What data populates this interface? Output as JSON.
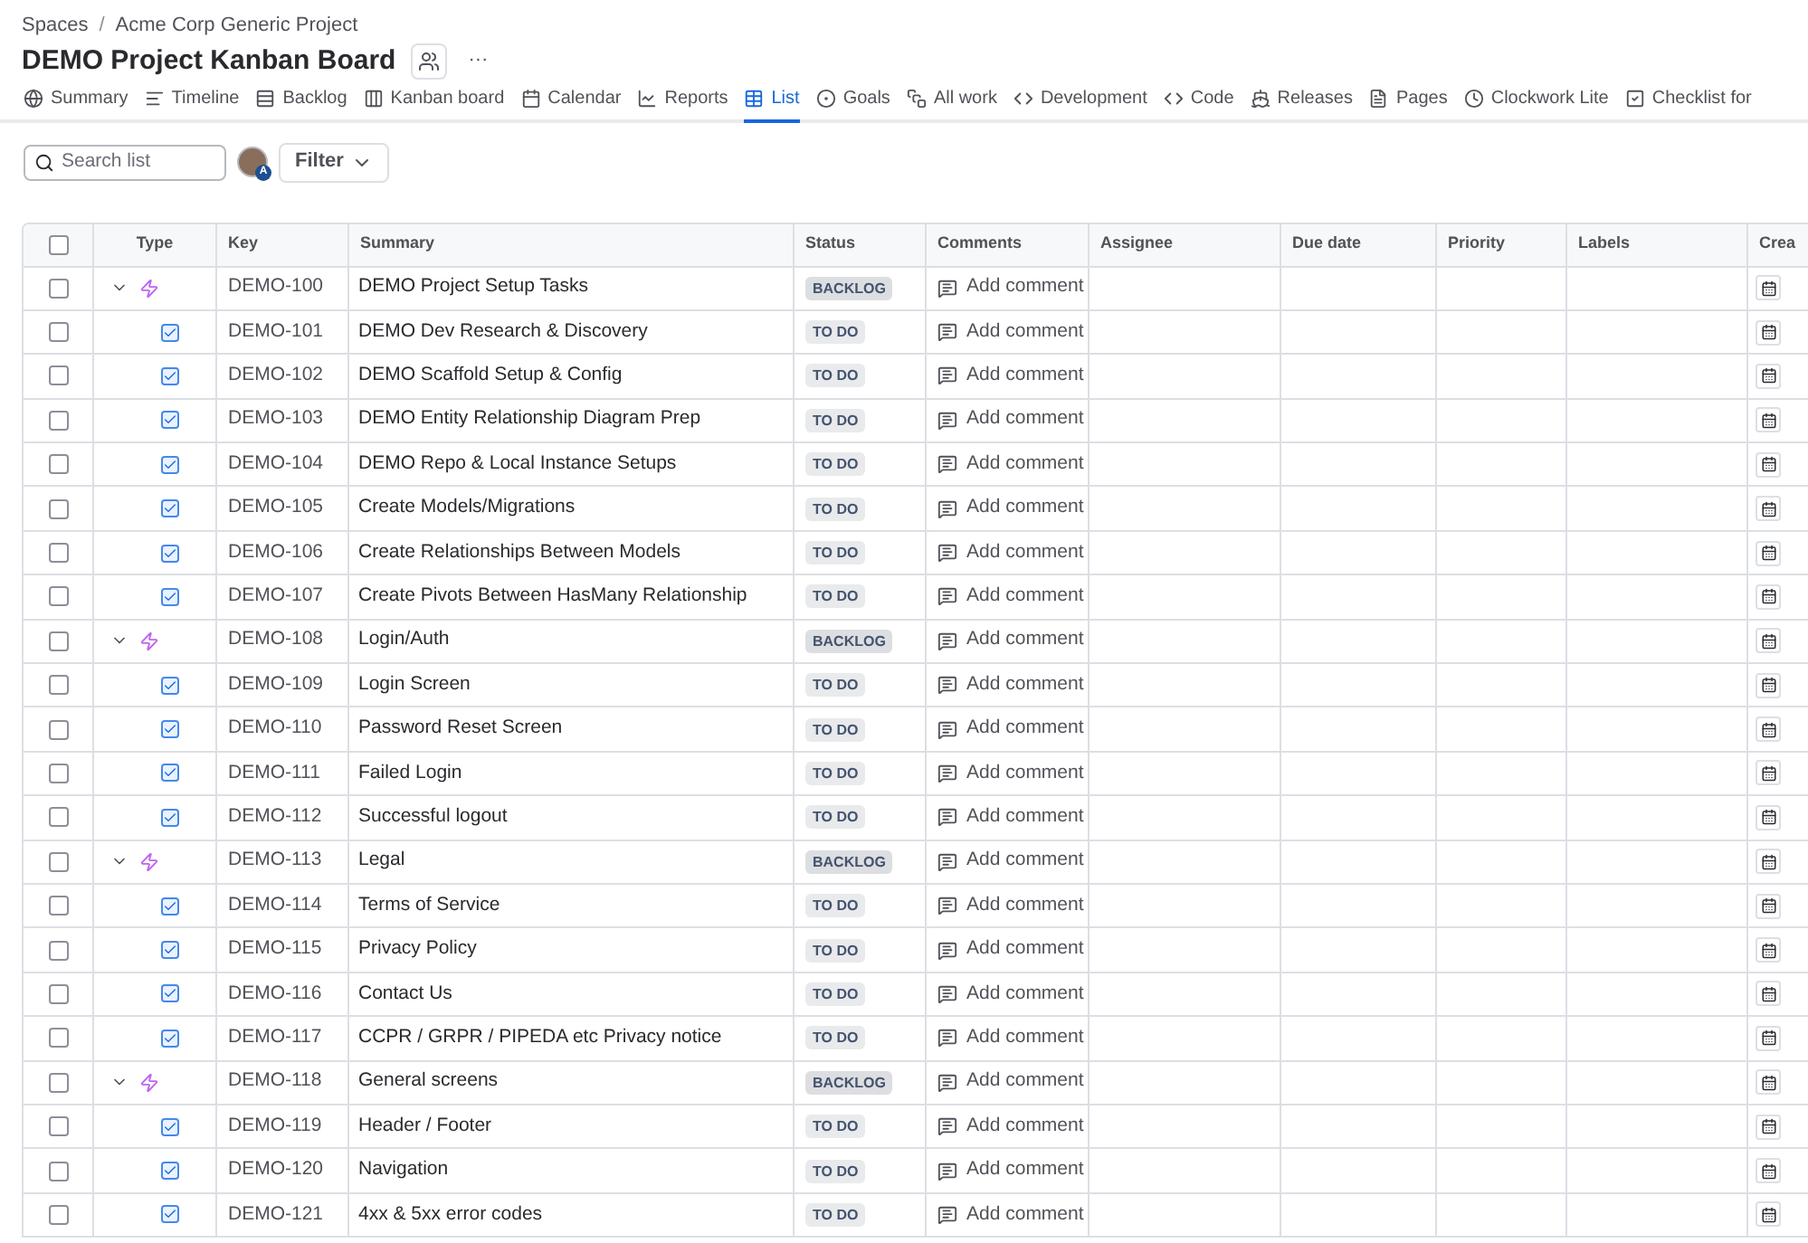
{
  "breadcrumbs": [
    "Spaces",
    "Acme Corp Generic Project"
  ],
  "breadcrumb_separator": "/",
  "title": "DEMO Project Kanban Board",
  "more": "···",
  "tabs": [
    {
      "label": "Summary",
      "selected": false
    },
    {
      "label": "Timeline",
      "selected": false
    },
    {
      "label": "Backlog",
      "selected": false
    },
    {
      "label": "Kanban board",
      "selected": false
    },
    {
      "label": "Calendar",
      "selected": false
    },
    {
      "label": "Reports",
      "selected": false
    },
    {
      "label": "List",
      "selected": true
    },
    {
      "label": "Goals",
      "selected": false
    },
    {
      "label": "All work",
      "selected": false
    },
    {
      "label": "Development",
      "selected": false
    },
    {
      "label": "Code",
      "selected": false
    },
    {
      "label": "Releases",
      "selected": false
    },
    {
      "label": "Pages",
      "selected": false
    },
    {
      "label": "Clockwork Lite",
      "selected": false
    },
    {
      "label": "Checklist for",
      "selected": false
    }
  ],
  "search": {
    "placeholder": "Search list"
  },
  "avatar_badge": "A",
  "filter": "Filter",
  "table": {
    "select_all": {
      "checked": false
    },
    "columns": [
      "Type",
      "Key",
      "Summary",
      "Status",
      "Comments",
      "Assignee",
      "Due date",
      "Priority",
      "Labels",
      "Crea"
    ],
    "rows": [
      {
        "kind": "epic",
        "expanded": true,
        "checked": false,
        "key": "DEMO-100",
        "summary": "DEMO Project Setup Tasks",
        "status": "BACKLOG",
        "comment": "Add comment"
      },
      {
        "kind": "task",
        "checked": false,
        "key": "DEMO-101",
        "summary": "DEMO Dev Research & Discovery",
        "status": "TO DO",
        "comment": "Add comment"
      },
      {
        "kind": "task",
        "checked": false,
        "key": "DEMO-102",
        "summary": "DEMO Scaffold Setup & Config",
        "status": "TO DO",
        "comment": "Add comment"
      },
      {
        "kind": "task",
        "checked": false,
        "key": "DEMO-103",
        "summary": "DEMO Entity Relationship Diagram Prep",
        "status": "TO DO",
        "comment": "Add comment"
      },
      {
        "kind": "task",
        "checked": false,
        "key": "DEMO-104",
        "summary": "DEMO Repo & Local Instance Setups",
        "status": "TO DO",
        "comment": "Add comment"
      },
      {
        "kind": "task",
        "checked": false,
        "key": "DEMO-105",
        "summary": "Create Models/Migrations",
        "status": "TO DO",
        "comment": "Add comment"
      },
      {
        "kind": "task",
        "checked": false,
        "key": "DEMO-106",
        "summary": "Create Relationships Between Models",
        "status": "TO DO",
        "comment": "Add comment"
      },
      {
        "kind": "task",
        "checked": false,
        "key": "DEMO-107",
        "summary": "Create Pivots Between HasMany Relationship",
        "status": "TO DO",
        "comment": "Add comment"
      },
      {
        "kind": "epic",
        "expanded": true,
        "checked": false,
        "key": "DEMO-108",
        "summary": "Login/Auth",
        "status": "BACKLOG",
        "comment": "Add comment"
      },
      {
        "kind": "task",
        "checked": false,
        "key": "DEMO-109",
        "summary": "Login Screen",
        "status": "TO DO",
        "comment": "Add comment"
      },
      {
        "kind": "task",
        "checked": false,
        "key": "DEMO-110",
        "summary": "Password Reset Screen",
        "status": "TO DO",
        "comment": "Add comment"
      },
      {
        "kind": "task",
        "checked": false,
        "key": "DEMO-111",
        "summary": "Failed Login",
        "status": "TO DO",
        "comment": "Add comment"
      },
      {
        "kind": "task",
        "checked": false,
        "key": "DEMO-112",
        "summary": "Successful logout",
        "status": "TO DO",
        "comment": "Add comment"
      },
      {
        "kind": "epic",
        "expanded": true,
        "checked": false,
        "key": "DEMO-113",
        "summary": "Legal",
        "status": "BACKLOG",
        "comment": "Add comment"
      },
      {
        "kind": "task",
        "checked": false,
        "key": "DEMO-114",
        "summary": "Terms of Service",
        "status": "TO DO",
        "comment": "Add comment"
      },
      {
        "kind": "task",
        "checked": false,
        "key": "DEMO-115",
        "summary": "Privacy Policy",
        "status": "TO DO",
        "comment": "Add comment"
      },
      {
        "kind": "task",
        "checked": false,
        "key": "DEMO-116",
        "summary": "Contact Us",
        "status": "TO DO",
        "comment": "Add comment"
      },
      {
        "kind": "task",
        "checked": false,
        "key": "DEMO-117",
        "summary": "CCPR / GRPR / PIPEDA etc Privacy notice",
        "status": "TO DO",
        "comment": "Add comment"
      },
      {
        "kind": "epic",
        "expanded": true,
        "checked": false,
        "key": "DEMO-118",
        "summary": "General screens",
        "status": "BACKLOG",
        "comment": "Add comment"
      },
      {
        "kind": "task",
        "checked": false,
        "key": "DEMO-119",
        "summary": "Header / Footer",
        "status": "TO DO",
        "comment": "Add comment"
      },
      {
        "kind": "task",
        "checked": false,
        "key": "DEMO-120",
        "summary": "Navigation",
        "status": "TO DO",
        "comment": "Add comment"
      },
      {
        "kind": "task",
        "checked": false,
        "key": "DEMO-121",
        "summary": "4xx & 5xx error codes",
        "status": "TO DO",
        "comment": "Add comment"
      }
    ]
  }
}
